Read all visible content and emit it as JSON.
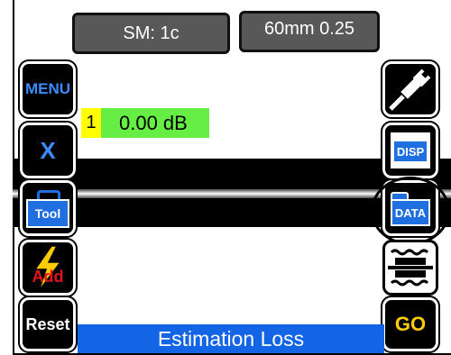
{
  "top": {
    "mode_label": "SM: 1c",
    "fiber_label": "60mm 0.25"
  },
  "left_buttons": {
    "menu": "MENU",
    "x": "X",
    "tool": "Tool",
    "add": "Add",
    "reset": "Reset"
  },
  "right_buttons": {
    "disp": "DISP",
    "data": "DATA",
    "go": "GO"
  },
  "loss": {
    "index": "1",
    "value": "0.00 dB"
  },
  "status": {
    "text": "Estimation Loss"
  },
  "colors": {
    "accent_blue": "#1464e6",
    "go_yellow": "#ffcc00",
    "loss_green": "#66ee44",
    "index_yellow": "#ffff00"
  },
  "icons": [
    "plug-icon",
    "fiber-holder-icon",
    "lightning-icon",
    "toolbox-icon",
    "folder-icon"
  ]
}
